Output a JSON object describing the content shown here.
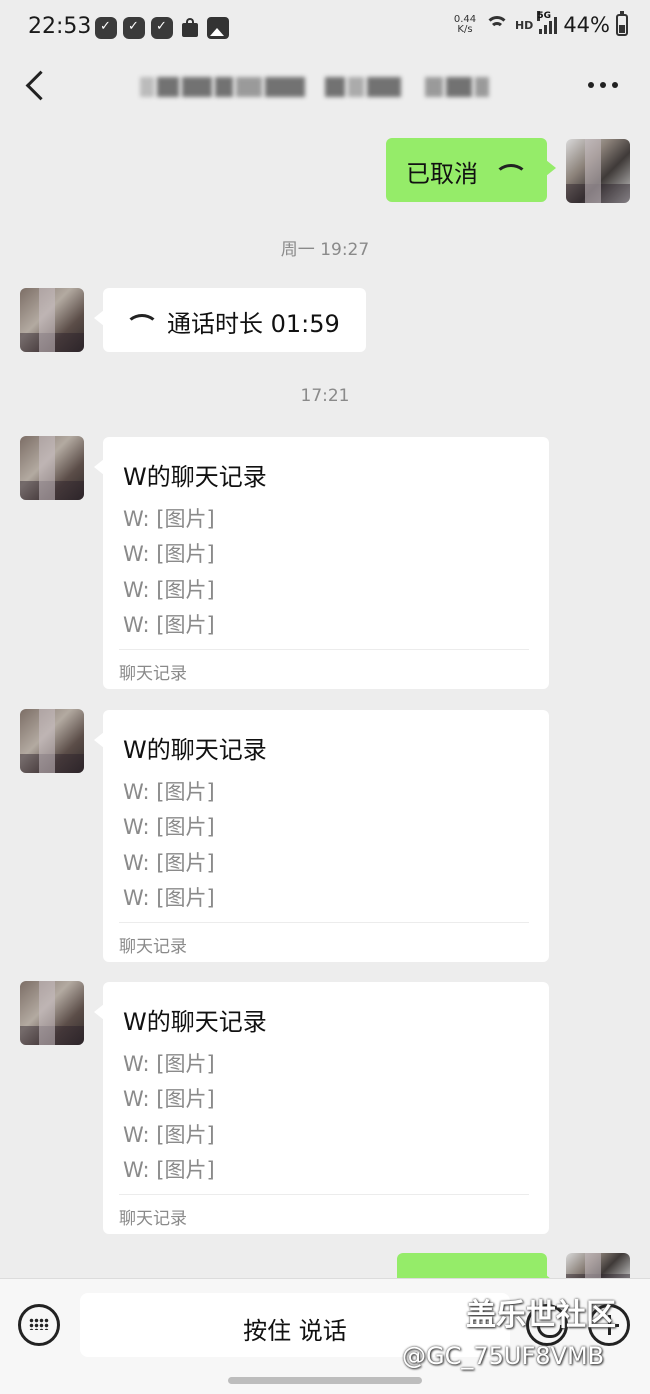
{
  "status_bar": {
    "time": "22:53",
    "net_speed_value": "0.44",
    "net_speed_unit": "K/s",
    "hd": "HD",
    "network": "5G",
    "battery": "44%"
  },
  "messages": {
    "cancelled_call": "已取消",
    "time_1": "周一 19:27",
    "call_duration": "通话时长 01:59",
    "time_2": "17:21",
    "records": [
      {
        "title": "W的聊天记录",
        "lines": [
          "W: [图片]",
          "W: [图片]",
          "W: [图片]",
          "W: [图片]"
        ],
        "footer": "聊天记录"
      },
      {
        "title": "W的聊天记录",
        "lines": [
          "W: [图片]",
          "W: [图片]",
          "W: [图片]",
          "W: [图片]"
        ],
        "footer": "聊天记录"
      },
      {
        "title": "W的聊天记录",
        "lines": [
          "W: [图片]",
          "W: [图片]",
          "W: [图片]",
          "W: [图片]"
        ],
        "footer": "聊天记录"
      }
    ]
  },
  "input_bar": {
    "hold_to_talk": "按住 说话"
  },
  "watermark": {
    "site": "盖乐世社区",
    "user": "@GC_75UF8VMB"
  },
  "colors": {
    "background": "#ededed",
    "sent_bubble": "#95ec69",
    "received_bubble": "#ffffff"
  }
}
